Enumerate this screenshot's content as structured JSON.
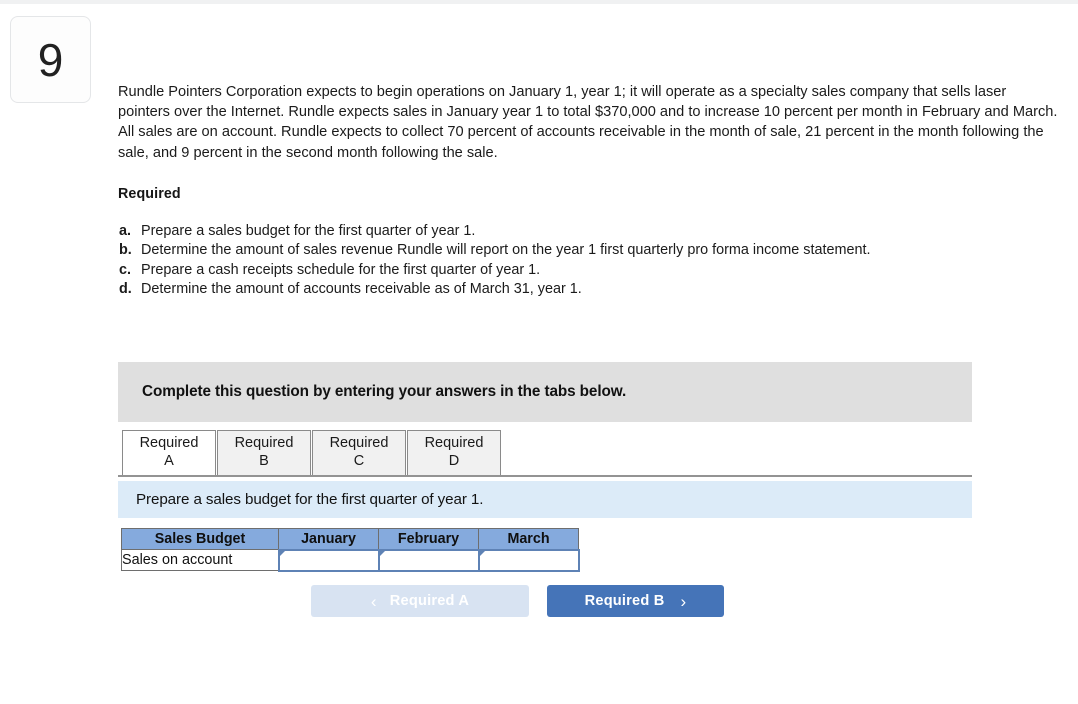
{
  "question": {
    "number": "9",
    "prompt": "Rundle Pointers Corporation expects to begin operations on January 1, year 1; it will operate as a specialty sales company that sells laser pointers over the Internet. Rundle expects sales in January year 1 to total $370,000 and to increase 10 percent per month in February and March. All sales are on account. Rundle expects to collect 70 percent of accounts receivable in the month of sale, 21 percent in the month following the sale, and 9 percent in the second month following the sale.",
    "required_heading": "Required",
    "requirements": [
      {
        "letter": "a.",
        "text": "Prepare a sales budget for the first quarter of year 1."
      },
      {
        "letter": "b.",
        "text": "Determine the amount of sales revenue Rundle will report on the year 1 first quarterly pro forma income statement."
      },
      {
        "letter": "c.",
        "text": "Prepare a cash receipts schedule for the first quarter of year 1."
      },
      {
        "letter": "d.",
        "text": "Determine the amount of accounts receivable as of March 31, year 1."
      }
    ]
  },
  "banner": {
    "text": "Complete this question by entering your answers in the tabs below."
  },
  "tabs": [
    {
      "line1": "Required",
      "line2": "A",
      "active": true
    },
    {
      "line1": "Required",
      "line2": "B",
      "active": false
    },
    {
      "line1": "Required",
      "line2": "C",
      "active": false
    },
    {
      "line1": "Required",
      "line2": "D",
      "active": false
    }
  ],
  "instruction": {
    "text": "Prepare a sales budget for the first quarter of year 1."
  },
  "table": {
    "headers": [
      "Sales Budget",
      "January",
      "February",
      "March"
    ],
    "rows": [
      {
        "label": "Sales on account",
        "values": [
          "",
          "",
          ""
        ]
      }
    ]
  },
  "navigation": {
    "prev_label": "Required A",
    "prev_icon": "chevron-left",
    "prev_glyph": "‹",
    "next_label": "Required B",
    "next_icon": "chevron-right",
    "next_glyph": "›"
  },
  "colors": {
    "banner_gray": "#dfdfdf",
    "instruction_blue": "#dcebf8",
    "table_header_blue": "#85aadd",
    "input_border_blue": "#5e82b5",
    "next_button_blue": "#4574b8",
    "prev_button_blue": "#d8e3f2"
  }
}
